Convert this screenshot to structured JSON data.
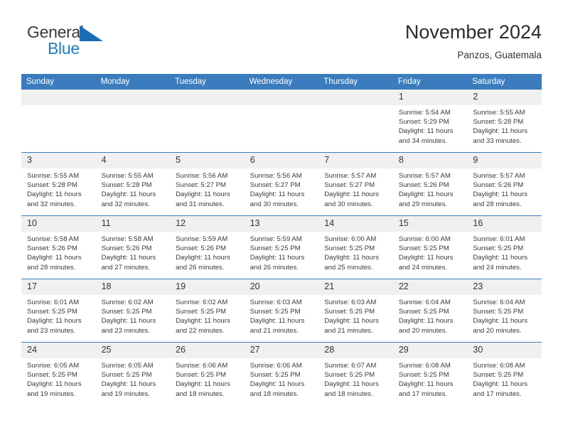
{
  "brand": {
    "name_part1": "General",
    "name_part2": "Blue",
    "triangle_color": "#1a6db5",
    "blue_color": "#1f7ec4"
  },
  "header": {
    "title": "November 2024",
    "subtitle": "Panzos, Guatemala"
  },
  "theme": {
    "header_blue": "#3a7cbe",
    "daynum_gray": "#f0f0f0"
  },
  "weekday_headers": [
    "Sunday",
    "Monday",
    "Tuesday",
    "Wednesday",
    "Thursday",
    "Friday",
    "Saturday"
  ],
  "labels": {
    "sunrise": "Sunrise:",
    "sunset": "Sunset:",
    "daylight": "Daylight:"
  },
  "weeks": [
    [
      {
        "day": "",
        "blank": true
      },
      {
        "day": "",
        "blank": true
      },
      {
        "day": "",
        "blank": true
      },
      {
        "day": "",
        "blank": true
      },
      {
        "day": "",
        "blank": true
      },
      {
        "day": "1",
        "sunrise": "Sunrise: 5:54 AM",
        "sunset": "Sunset: 5:29 PM",
        "daylight": "Daylight: 11 hours and 34 minutes."
      },
      {
        "day": "2",
        "sunrise": "Sunrise: 5:55 AM",
        "sunset": "Sunset: 5:28 PM",
        "daylight": "Daylight: 11 hours and 33 minutes."
      }
    ],
    [
      {
        "day": "3",
        "sunrise": "Sunrise: 5:55 AM",
        "sunset": "Sunset: 5:28 PM",
        "daylight": "Daylight: 11 hours and 32 minutes."
      },
      {
        "day": "4",
        "sunrise": "Sunrise: 5:55 AM",
        "sunset": "Sunset: 5:28 PM",
        "daylight": "Daylight: 11 hours and 32 minutes."
      },
      {
        "day": "5",
        "sunrise": "Sunrise: 5:56 AM",
        "sunset": "Sunset: 5:27 PM",
        "daylight": "Daylight: 11 hours and 31 minutes."
      },
      {
        "day": "6",
        "sunrise": "Sunrise: 5:56 AM",
        "sunset": "Sunset: 5:27 PM",
        "daylight": "Daylight: 11 hours and 30 minutes."
      },
      {
        "day": "7",
        "sunrise": "Sunrise: 5:57 AM",
        "sunset": "Sunset: 5:27 PM",
        "daylight": "Daylight: 11 hours and 30 minutes."
      },
      {
        "day": "8",
        "sunrise": "Sunrise: 5:57 AM",
        "sunset": "Sunset: 5:26 PM",
        "daylight": "Daylight: 11 hours and 29 minutes."
      },
      {
        "day": "9",
        "sunrise": "Sunrise: 5:57 AM",
        "sunset": "Sunset: 5:26 PM",
        "daylight": "Daylight: 11 hours and 28 minutes."
      }
    ],
    [
      {
        "day": "10",
        "sunrise": "Sunrise: 5:58 AM",
        "sunset": "Sunset: 5:26 PM",
        "daylight": "Daylight: 11 hours and 28 minutes."
      },
      {
        "day": "11",
        "sunrise": "Sunrise: 5:58 AM",
        "sunset": "Sunset: 5:26 PM",
        "daylight": "Daylight: 11 hours and 27 minutes."
      },
      {
        "day": "12",
        "sunrise": "Sunrise: 5:59 AM",
        "sunset": "Sunset: 5:26 PM",
        "daylight": "Daylight: 11 hours and 26 minutes."
      },
      {
        "day": "13",
        "sunrise": "Sunrise: 5:59 AM",
        "sunset": "Sunset: 5:25 PM",
        "daylight": "Daylight: 11 hours and 26 minutes."
      },
      {
        "day": "14",
        "sunrise": "Sunrise: 6:00 AM",
        "sunset": "Sunset: 5:25 PM",
        "daylight": "Daylight: 11 hours and 25 minutes."
      },
      {
        "day": "15",
        "sunrise": "Sunrise: 6:00 AM",
        "sunset": "Sunset: 5:25 PM",
        "daylight": "Daylight: 11 hours and 24 minutes."
      },
      {
        "day": "16",
        "sunrise": "Sunrise: 6:01 AM",
        "sunset": "Sunset: 5:25 PM",
        "daylight": "Daylight: 11 hours and 24 minutes."
      }
    ],
    [
      {
        "day": "17",
        "sunrise": "Sunrise: 6:01 AM",
        "sunset": "Sunset: 5:25 PM",
        "daylight": "Daylight: 11 hours and 23 minutes."
      },
      {
        "day": "18",
        "sunrise": "Sunrise: 6:02 AM",
        "sunset": "Sunset: 5:25 PM",
        "daylight": "Daylight: 11 hours and 23 minutes."
      },
      {
        "day": "19",
        "sunrise": "Sunrise: 6:02 AM",
        "sunset": "Sunset: 5:25 PM",
        "daylight": "Daylight: 11 hours and 22 minutes."
      },
      {
        "day": "20",
        "sunrise": "Sunrise: 6:03 AM",
        "sunset": "Sunset: 5:25 PM",
        "daylight": "Daylight: 11 hours and 21 minutes."
      },
      {
        "day": "21",
        "sunrise": "Sunrise: 6:03 AM",
        "sunset": "Sunset: 5:25 PM",
        "daylight": "Daylight: 11 hours and 21 minutes."
      },
      {
        "day": "22",
        "sunrise": "Sunrise: 6:04 AM",
        "sunset": "Sunset: 5:25 PM",
        "daylight": "Daylight: 11 hours and 20 minutes."
      },
      {
        "day": "23",
        "sunrise": "Sunrise: 6:04 AM",
        "sunset": "Sunset: 5:25 PM",
        "daylight": "Daylight: 11 hours and 20 minutes."
      }
    ],
    [
      {
        "day": "24",
        "sunrise": "Sunrise: 6:05 AM",
        "sunset": "Sunset: 5:25 PM",
        "daylight": "Daylight: 11 hours and 19 minutes."
      },
      {
        "day": "25",
        "sunrise": "Sunrise: 6:05 AM",
        "sunset": "Sunset: 5:25 PM",
        "daylight": "Daylight: 11 hours and 19 minutes."
      },
      {
        "day": "26",
        "sunrise": "Sunrise: 6:06 AM",
        "sunset": "Sunset: 5:25 PM",
        "daylight": "Daylight: 11 hours and 18 minutes."
      },
      {
        "day": "27",
        "sunrise": "Sunrise: 6:06 AM",
        "sunset": "Sunset: 5:25 PM",
        "daylight": "Daylight: 11 hours and 18 minutes."
      },
      {
        "day": "28",
        "sunrise": "Sunrise: 6:07 AM",
        "sunset": "Sunset: 5:25 PM",
        "daylight": "Daylight: 11 hours and 18 minutes."
      },
      {
        "day": "29",
        "sunrise": "Sunrise: 6:08 AM",
        "sunset": "Sunset: 5:25 PM",
        "daylight": "Daylight: 11 hours and 17 minutes."
      },
      {
        "day": "30",
        "sunrise": "Sunrise: 6:08 AM",
        "sunset": "Sunset: 5:25 PM",
        "daylight": "Daylight: 11 hours and 17 minutes."
      }
    ]
  ]
}
